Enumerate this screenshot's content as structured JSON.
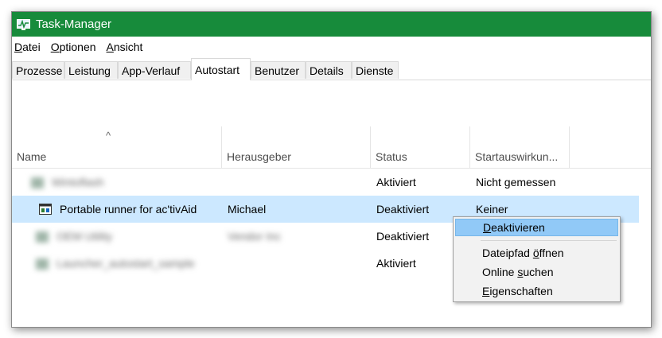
{
  "window": {
    "title": "Task-Manager"
  },
  "menubar": [
    {
      "pre": "",
      "acc": "D",
      "post": "atei"
    },
    {
      "pre": "",
      "acc": "O",
      "post": "ptionen"
    },
    {
      "pre": "",
      "acc": "A",
      "post": "nsicht"
    }
  ],
  "tabs": [
    "Prozesse",
    "Leistung",
    "App-Verlauf",
    "Autostart",
    "Benutzer",
    "Details",
    "Dienste"
  ],
  "active_tab": "Autostart",
  "columns": {
    "name": "Name",
    "publisher": "Herausgeber",
    "status": "Status",
    "impact": "Startauswirkun..."
  },
  "rows": [
    {
      "name": "Wintoflash",
      "publisher": "",
      "status": "Aktiviert",
      "impact": "Nicht gemessen"
    },
    {
      "name": "Portable runner for ac'tivAid",
      "publisher": "Michael",
      "status": "Deaktiviert",
      "impact": "Keiner"
    },
    {
      "name": "OEM Utility",
      "publisher": "Vendor Inc",
      "status": "Deaktiviert",
      "impact": ""
    },
    {
      "name": "Launcher_autostart_sample",
      "publisher": "",
      "status": "Aktiviert",
      "impact": ""
    }
  ],
  "context_menu": [
    {
      "pre": "",
      "acc": "D",
      "post": "eaktivieren"
    },
    {
      "pre": "Dateipfad ",
      "acc": "ö",
      "post": "ffnen"
    },
    {
      "pre": "Online ",
      "acc": "s",
      "post": "uchen"
    },
    {
      "pre": "",
      "acc": "E",
      "post": "igenschaften"
    }
  ],
  "colors": {
    "titlebar": "#178b3b",
    "selection": "#cce8ff",
    "menu_highlight": "#91c9f7"
  }
}
